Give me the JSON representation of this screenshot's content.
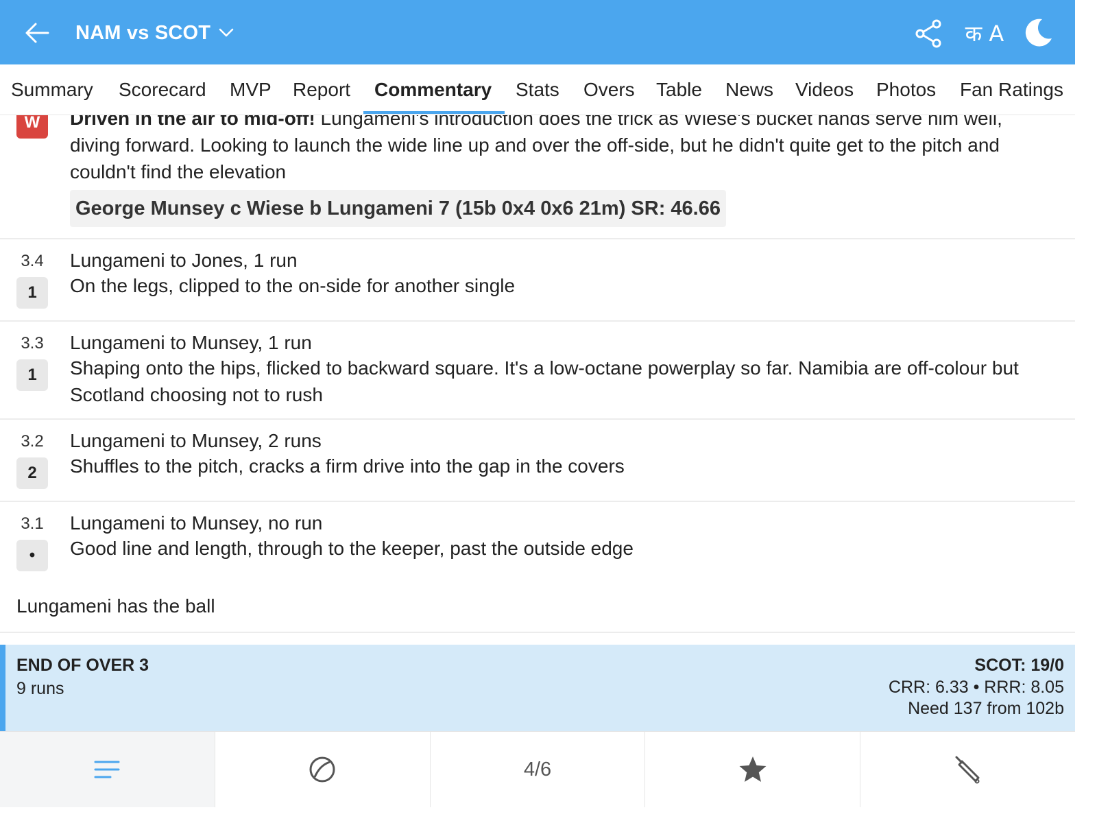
{
  "header": {
    "title": "NAM vs SCOT",
    "lang_label": "क A",
    "icons": [
      "back-arrow-icon",
      "chevron-down-icon",
      "share-icon",
      "language-icon",
      "moon-icon"
    ],
    "background": "#4ba6ee"
  },
  "tabs": [
    {
      "label": "Summary"
    },
    {
      "label": "Scorecard"
    },
    {
      "label": "MVP"
    },
    {
      "label": "Report"
    },
    {
      "label": "Commentary",
      "active": true
    },
    {
      "label": "Stats"
    },
    {
      "label": "Overs"
    },
    {
      "label": "Table"
    },
    {
      "label": "News"
    },
    {
      "label": "Videos"
    },
    {
      "label": "Photos"
    },
    {
      "label": "Fan Ratings"
    }
  ],
  "commentary": {
    "wicket": {
      "badge": "W",
      "lead": "Driven in the air to mid-off!",
      "text_line1": " Lungameni's introduction does the trick as Wiese's bucket hands serve him well,",
      "text_rest": "diving forward. Looking to launch the wide line up and over the off-side, but he didn't quite get to the pitch and couldn't find the elevation",
      "dismissal": "George Munsey c Wiese b Lungameni 7 (15b 0x4 0x6 21m) SR: 46.66"
    },
    "balls": [
      {
        "over": "3.4",
        "badge": "1",
        "title": "Lungameni to Jones, 1 run",
        "text": "On the legs, clipped to the on-side for another single"
      },
      {
        "over": "3.3",
        "badge": "1",
        "title": "Lungameni to Munsey, 1 run",
        "text": "Shaping onto the hips, flicked to backward square. It's a low-octane powerplay so far. Namibia are off-colour but Scotland choosing not to rush"
      },
      {
        "over": "3.2",
        "badge": "2",
        "title": "Lungameni to Munsey, 2 runs",
        "text": "Shuffles to the pitch, cracks a firm drive into the gap in the covers"
      },
      {
        "over": "3.1",
        "badge": "•",
        "title": "Lungameni to Munsey, no run",
        "text": "Good line and length, through to the keeper, past the outside edge"
      }
    ],
    "bowler_note": "Lungameni has the ball",
    "colors": {
      "wicket": "#d9453f",
      "badge": "#e8e8e8"
    }
  },
  "over_summary": {
    "title": "END OF OVER 3",
    "runs": "9 runs",
    "score": "SCOT: 19/0",
    "rates": "CRR: 6.33 • RRR: 8.05",
    "need": "Need 137 from 102b",
    "background": "#d5eaf9"
  },
  "bottom_nav": {
    "items": [
      {
        "icon": "list-icon",
        "active": true
      },
      {
        "icon": "ball-icon"
      },
      {
        "label": "4/6"
      },
      {
        "icon": "star-icon"
      },
      {
        "icon": "bat-icon"
      }
    ]
  }
}
